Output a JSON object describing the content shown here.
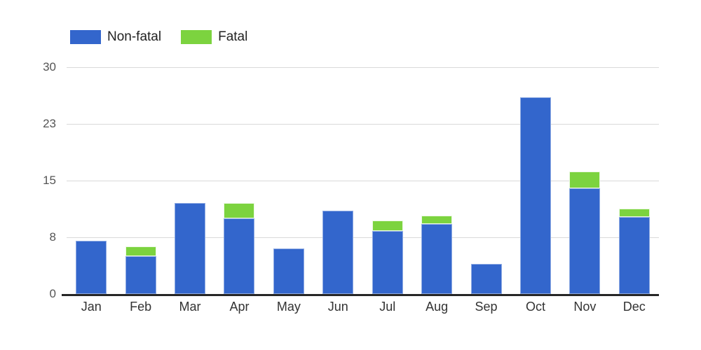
{
  "legend": {
    "position": "top-left",
    "items": [
      {
        "label": "Non-fatal",
        "color": "#3366cc"
      },
      {
        "label": "Fatal",
        "color": "#7cd33f"
      }
    ]
  },
  "axes": {
    "y_ticks": [
      "0",
      "8",
      "15",
      "23",
      "30"
    ],
    "x_ticks": [
      "Jan",
      "Feb",
      "Mar",
      "Apr",
      "May",
      "Jun",
      "Jul",
      "Aug",
      "Sep",
      "Oct",
      "Nov",
      "Dec"
    ]
  },
  "chart_data": {
    "type": "bar",
    "stacked": true,
    "title": "",
    "subtitle": "",
    "xlabel": "",
    "ylabel": "",
    "categories": [
      "Jan",
      "Feb",
      "Mar",
      "Apr",
      "May",
      "Jun",
      "Jul",
      "Aug",
      "Sep",
      "Oct",
      "Nov",
      "Dec"
    ],
    "series": [
      {
        "name": "Non-fatal",
        "color": "#3366cc",
        "values": [
          7,
          5,
          12,
          10,
          6,
          11,
          8.3,
          9.3,
          4,
          26,
          14,
          10.2
        ]
      },
      {
        "name": "Fatal",
        "color": "#7cd33f",
        "values": [
          0,
          1.3,
          0,
          2,
          0,
          0,
          1.4,
          1.1,
          0,
          0,
          2.2,
          1.1
        ]
      }
    ],
    "totals": [
      7,
      6.3,
      12,
      12,
      6,
      11,
      9.7,
      10.4,
      4,
      26,
      16.2,
      11.3
    ],
    "ylim": [
      0,
      30
    ],
    "ytick_values": [
      0,
      7.5,
      15,
      22.5,
      30
    ],
    "ytick_labels": [
      "0",
      "8",
      "15",
      "23",
      "30"
    ],
    "grid": true,
    "grid_axis": "y",
    "legend_position": "top-left",
    "background": "#ffffff"
  },
  "style": {
    "grid_color": "#d9d9d9",
    "axis_color": "#262626",
    "tick_text_color": "#555555",
    "label_text_color": "#333333"
  }
}
